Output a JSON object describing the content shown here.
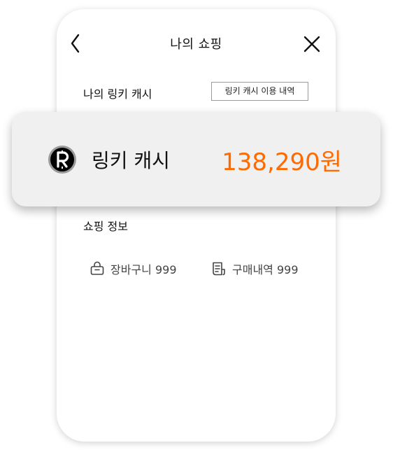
{
  "nav": {
    "title": "나의 쇼핑",
    "back_icon": "chevron-left-icon",
    "close_icon": "close-icon"
  },
  "cash_section": {
    "label": "나의 링키 캐시",
    "history_button": "링키 캐시 이용 내역"
  },
  "cash_card": {
    "icon": "r-coin-icon",
    "name": "링키 캐시",
    "amount": "138,290원",
    "amount_color": "#ff6a00"
  },
  "shopping_section": {
    "label": "쇼핑 정보",
    "items": [
      {
        "icon": "shopping-basket-icon",
        "label": "장바구니 999"
      },
      {
        "icon": "receipt-icon",
        "label": "구매내역 999"
      }
    ]
  }
}
